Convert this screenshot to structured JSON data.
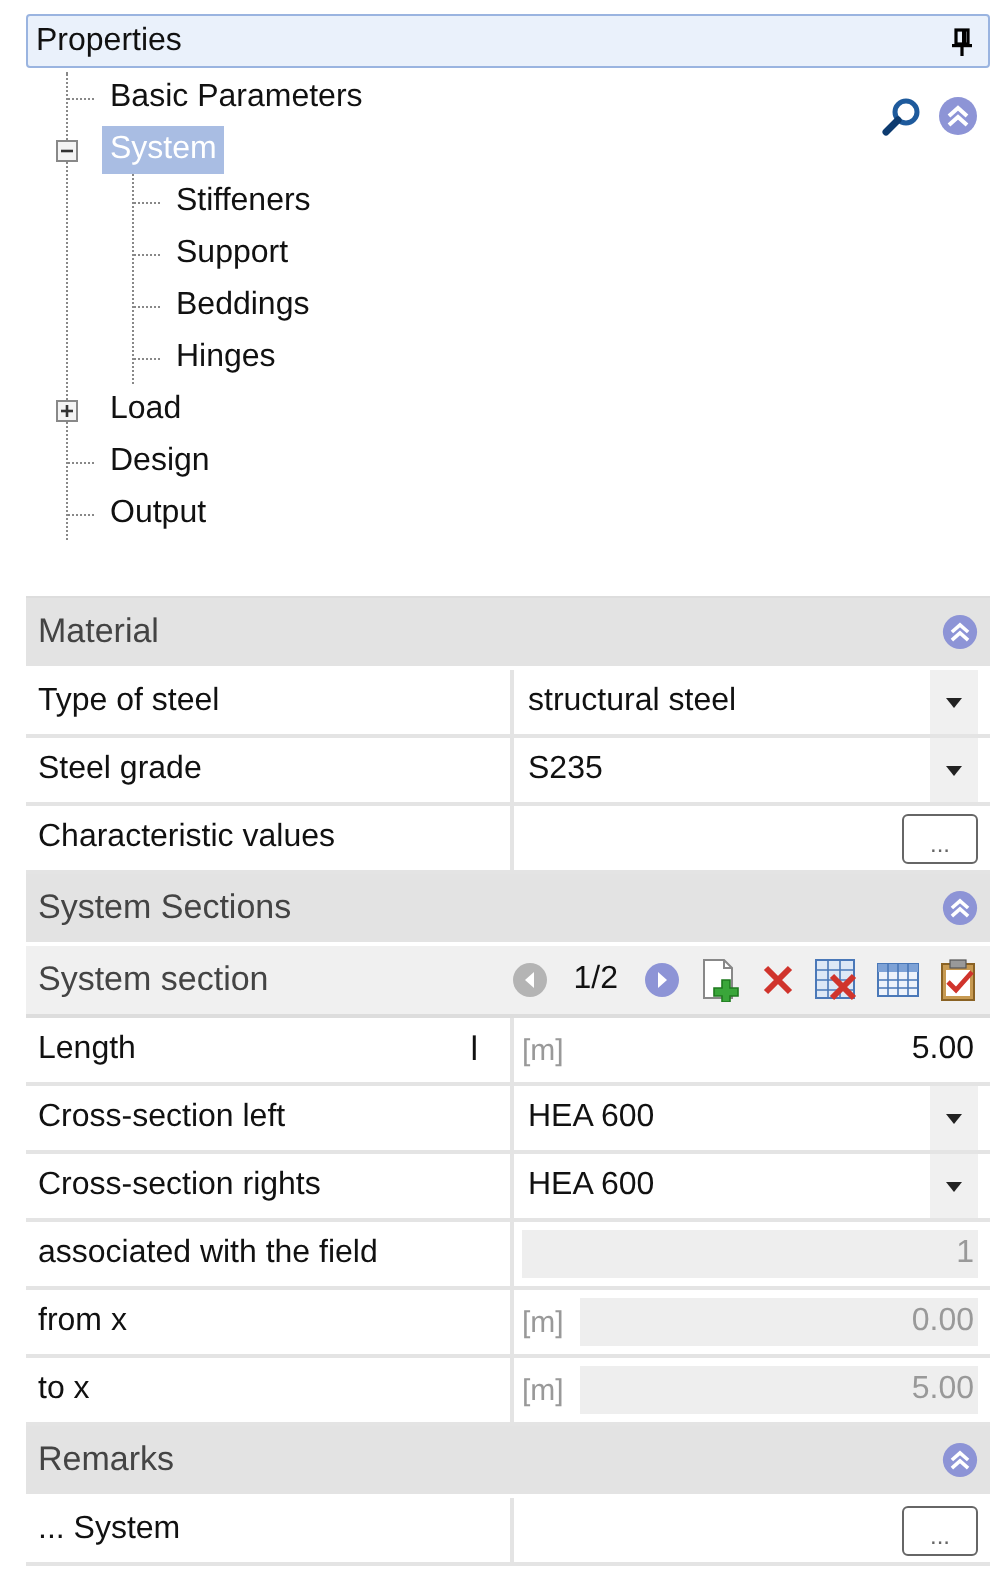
{
  "panel": {
    "title": "Properties"
  },
  "tree": [
    {
      "label": "Basic Parameters",
      "selected": false
    },
    {
      "label": "System",
      "selected": true,
      "expanded": true,
      "children": [
        {
          "label": "Stiffeners",
          "selected": false
        },
        {
          "label": "Support",
          "selected": false
        },
        {
          "label": "Beddings",
          "selected": false
        },
        {
          "label": "Hinges",
          "selected": false
        }
      ]
    },
    {
      "label": "Load",
      "selected": false,
      "expanded": false
    },
    {
      "label": "Design",
      "selected": false
    },
    {
      "label": "Output",
      "selected": false
    }
  ],
  "sections": [
    {
      "kind": "header",
      "title": "Material"
    },
    {
      "kind": "dropdown",
      "label": "Type of steel",
      "value": "structural steel"
    },
    {
      "kind": "dropdown",
      "label": "Steel grade",
      "value": "S235"
    },
    {
      "kind": "button",
      "label": "Characteristic values",
      "button": "..."
    },
    {
      "kind": "header",
      "title": "System Sections"
    },
    {
      "kind": "toolbar",
      "label": "System section",
      "page": "1/2",
      "prev_disabled": true
    },
    {
      "kind": "unit",
      "label": "Length",
      "symbol": "l",
      "unit": "[m]",
      "value": "5.00",
      "disabled": false
    },
    {
      "kind": "dropdown",
      "label": "Cross-section left",
      "value": "HEA 600"
    },
    {
      "kind": "dropdown",
      "label": "Cross-section rights",
      "value": "HEA 600"
    },
    {
      "kind": "readonly",
      "label": "associated with the field",
      "value": "1"
    },
    {
      "kind": "unit",
      "label": "from x",
      "unit": "[m]",
      "value": "0.00",
      "disabled": true
    },
    {
      "kind": "unit",
      "label": "to x",
      "unit": "[m]",
      "value": "5.00",
      "disabled": true
    },
    {
      "kind": "header",
      "title": "Remarks"
    },
    {
      "kind": "button",
      "label": "... System",
      "button": "..."
    }
  ]
}
